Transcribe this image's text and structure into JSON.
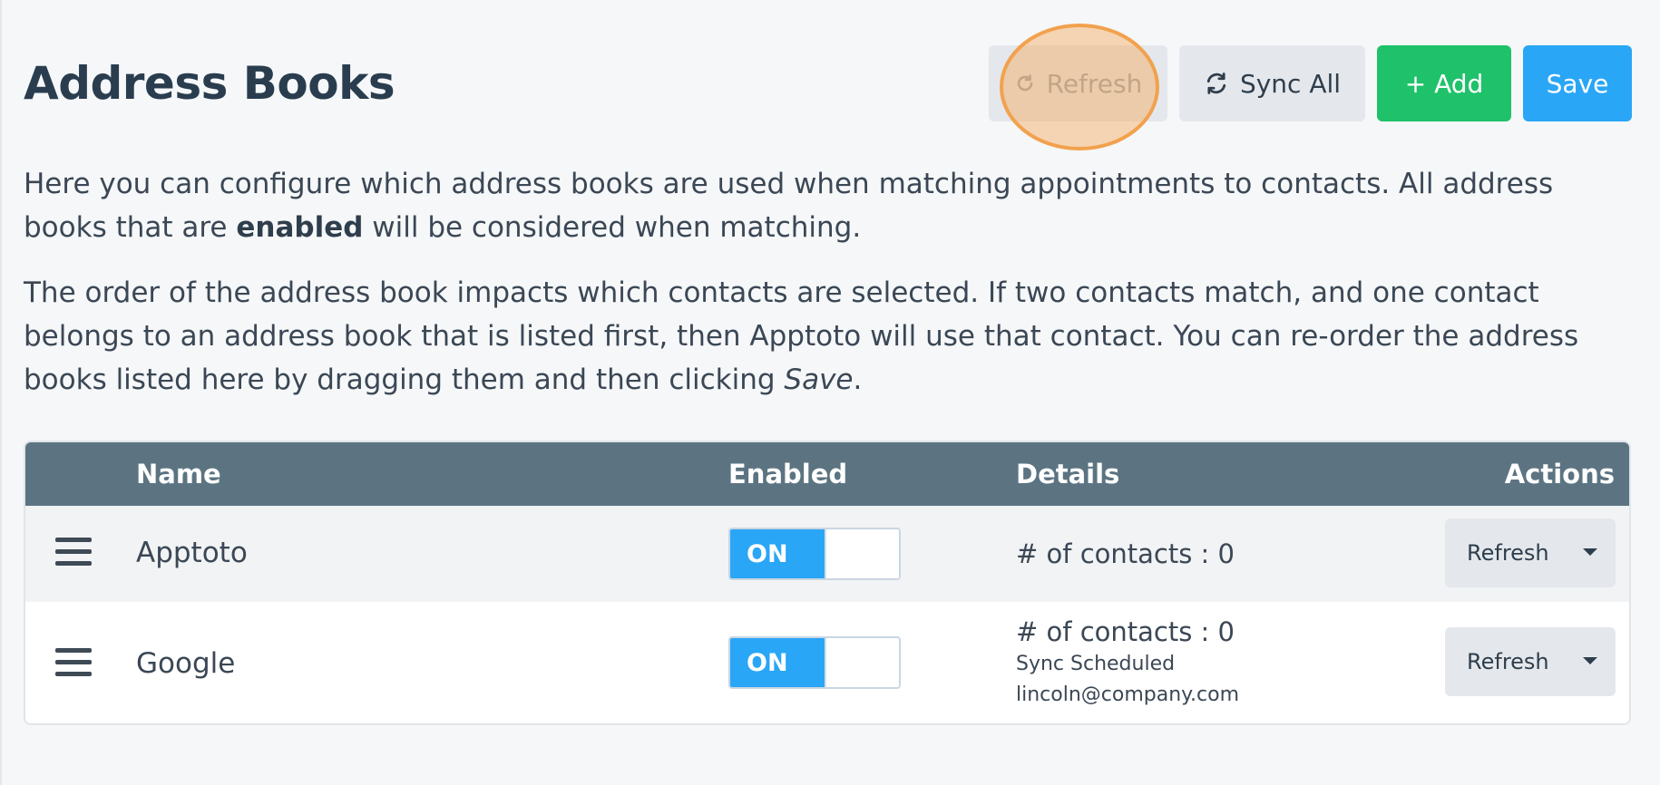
{
  "page": {
    "title": "Address Books"
  },
  "toolbar": {
    "refresh_label": "Refresh",
    "sync_all_label": "Sync All",
    "add_label": "+ Add",
    "save_label": "Save"
  },
  "description": {
    "p1_before": "Here you can configure which address books are used when matching appointments to contacts. All address books that are ",
    "p1_bold": "enabled",
    "p1_after": " will be considered when matching.",
    "p2_before": "The order of the address book impacts which contacts are selected. If two contacts match, and one contact belongs to an address book that is listed first, then Apptoto will use that contact. You can re-order the address books listed here by dragging them and then clicking ",
    "p2_italic": "Save",
    "p2_after": "."
  },
  "table": {
    "columns": {
      "name": "Name",
      "enabled": "Enabled",
      "details": "Details",
      "actions": "Actions"
    },
    "rows": [
      {
        "name": "Apptoto",
        "toggle": "ON",
        "contacts": "# of contacts : 0",
        "status": "",
        "account": "",
        "action": "Refresh"
      },
      {
        "name": "Google",
        "toggle": "ON",
        "contacts": "# of contacts : 0",
        "status": "Sync Scheduled",
        "account": "lincoln@company.com",
        "action": "Refresh"
      }
    ]
  },
  "colors": {
    "add": "#1fc26a",
    "save": "#2aa6f6",
    "header": "#5c7482",
    "highlight": "#f2a14e"
  },
  "icons": [
    "refresh-icon",
    "sync-icon",
    "drag-handle-icon",
    "caret-down-icon"
  ]
}
